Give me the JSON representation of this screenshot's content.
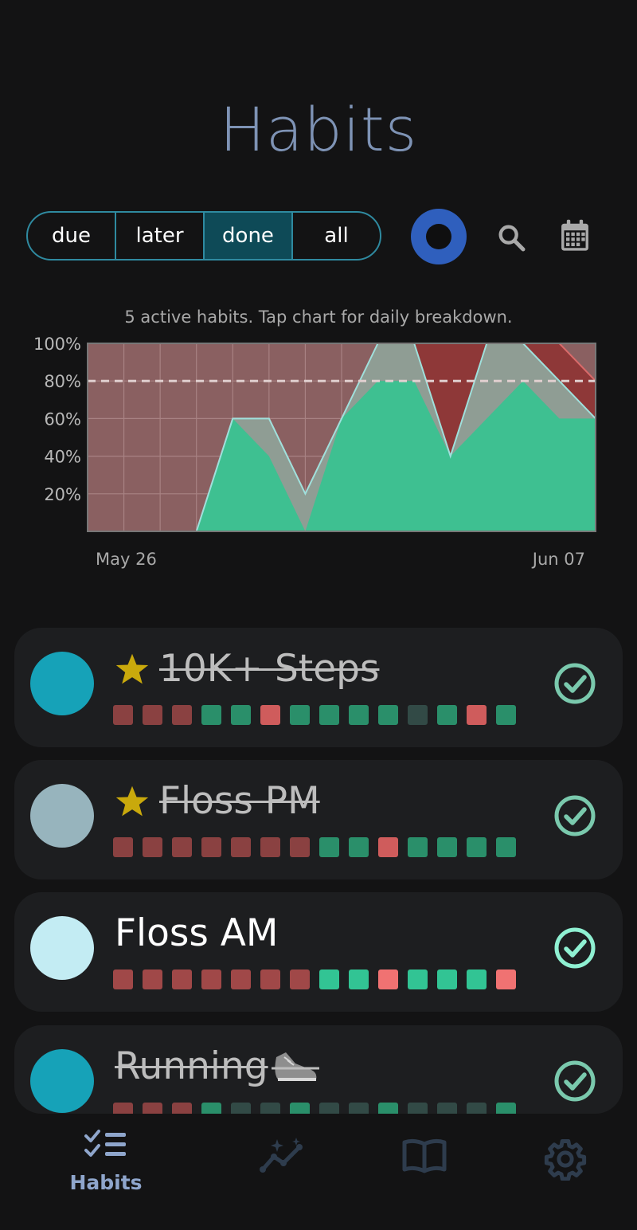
{
  "header": {
    "title": "Habits"
  },
  "filters": [
    {
      "label": "due",
      "active": false
    },
    {
      "label": "later",
      "active": false
    },
    {
      "label": "done",
      "active": true
    },
    {
      "label": "all",
      "active": false
    }
  ],
  "toolbar": {
    "ring_icon": "ring-icon",
    "search_icon": "search-icon",
    "calendar_icon": "calendar-icon"
  },
  "chart_caption": "5 active habits. Tap chart for daily breakdown.",
  "chart_data": {
    "type": "area",
    "x_start_label": "May 26",
    "x_end_label": "Jun 07",
    "y_tick_labels": [
      "100%",
      "80%",
      "60%",
      "40%",
      "20%"
    ],
    "ylim": [
      0,
      100
    ],
    "target_line": 80,
    "series": [
      {
        "values": [
          0,
          0,
          0,
          0,
          60,
          40,
          0,
          60,
          80,
          80,
          40,
          60,
          80,
          60,
          60
        ]
      },
      {
        "values": [
          0,
          0,
          0,
          0,
          60,
          60,
          20,
          60,
          100,
          100,
          40,
          100,
          100,
          80,
          60
        ]
      },
      {
        "values": [
          0,
          0,
          0,
          0,
          60,
          60,
          20,
          60,
          100,
          100,
          100,
          100,
          100,
          100,
          80
        ]
      }
    ],
    "colors": {
      "completed": "#3ec091",
      "background": "#8a6061",
      "missed": "#8e3838",
      "line": "#9fe0dc",
      "target": "#e0cfcf"
    }
  },
  "habits": [
    {
      "name": "10K+ Steps",
      "starred": true,
      "struck": true,
      "dot_color": "#16a2b8",
      "squares": [
        "#8a4141",
        "#8a4141",
        "#8a4141",
        "#2a8f6a",
        "#2a8f6a",
        "#cf5c5c",
        "#2a8f6a",
        "#2a8f6a",
        "#2a8f6a",
        "#2a8f6a",
        "#324a46",
        "#2a8f6a",
        "#cf5c5c",
        "#2a8f6a"
      ],
      "check_color": "#7ac9ad"
    },
    {
      "name": "Floss PM",
      "starred": true,
      "struck": true,
      "dot_color": "#97b4bd",
      "squares": [
        "#8a4141",
        "#8a4141",
        "#8a4141",
        "#8a4141",
        "#8a4141",
        "#8a4141",
        "#8a4141",
        "#2a8f6a",
        "#2a8f6a",
        "#cf5c5c",
        "#2a8f6a",
        "#2a8f6a",
        "#2a8f6a",
        "#2a8f6a"
      ],
      "check_color": "#7ac9ad"
    },
    {
      "name": "Floss AM",
      "starred": false,
      "struck": false,
      "dot_color": "#c3ecf3",
      "squares": [
        "#a04848",
        "#a04848",
        "#a04848",
        "#a04848",
        "#a04848",
        "#a04848",
        "#a04848",
        "#32c494",
        "#32c494",
        "#f07272",
        "#32c494",
        "#32c494",
        "#32c494",
        "#f07272"
      ],
      "check_color": "#8ff0d2"
    },
    {
      "name": "Running",
      "starred": false,
      "struck": true,
      "dot_color": "#16a2b8",
      "squares": [
        "#8a4141",
        "#8a4141",
        "#8a4141",
        "#2a8f6a",
        "#324a46",
        "#324a46",
        "#2a8f6a",
        "#324a46",
        "#324a46",
        "#2a8f6a",
        "#324a46",
        "#324a46",
        "#324a46",
        "#2a8f6a"
      ],
      "check_color": "#7ac9ad"
    }
  ],
  "nav": [
    {
      "label": "Habits",
      "icon": "checklist-icon",
      "active": true
    },
    {
      "label": "",
      "icon": "stats-sparkle-icon",
      "active": false
    },
    {
      "label": "",
      "icon": "book-icon",
      "active": false
    },
    {
      "label": "",
      "icon": "settings-gear-icon",
      "active": false
    }
  ]
}
